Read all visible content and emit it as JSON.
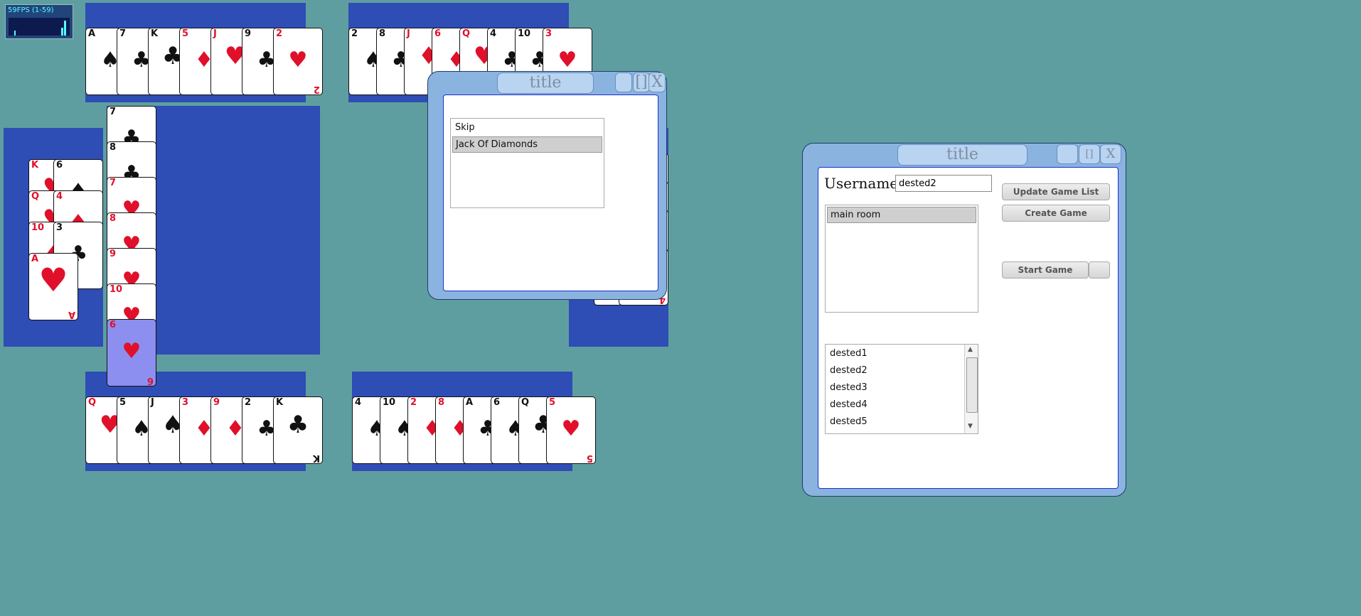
{
  "fps": {
    "label": "59FPS (1-59)"
  },
  "top_left_hand": [
    {
      "rank": "A",
      "suit": "♠",
      "color": "blk"
    },
    {
      "rank": "7",
      "suit": "♣",
      "color": "blk"
    },
    {
      "rank": "K",
      "suit": "♣",
      "color": "blk"
    },
    {
      "rank": "5",
      "suit": "♦",
      "color": "red"
    },
    {
      "rank": "J",
      "suit": "♥",
      "color": "red"
    },
    {
      "rank": "9",
      "suit": "♣",
      "color": "blk"
    },
    {
      "rank": "2",
      "suit": "♥",
      "color": "red"
    }
  ],
  "top_right_hand": [
    {
      "rank": "2",
      "suit": "♠",
      "color": "blk"
    },
    {
      "rank": "8",
      "suit": "♣",
      "color": "blk"
    },
    {
      "rank": "J",
      "suit": "♦",
      "color": "red"
    },
    {
      "rank": "6",
      "suit": "♦",
      "color": "red"
    },
    {
      "rank": "Q",
      "suit": "♥",
      "color": "red"
    },
    {
      "rank": "4",
      "suit": "♣",
      "color": "blk"
    },
    {
      "rank": "10",
      "suit": "♣",
      "color": "blk"
    },
    {
      "rank": "3",
      "suit": "♥",
      "color": "red"
    }
  ],
  "left_pile": [
    {
      "rank": "K",
      "suit": "♥",
      "color": "red"
    },
    {
      "rank": "6",
      "suit": "♠",
      "color": "blk"
    },
    {
      "rank": "Q",
      "suit": "♥",
      "color": "red"
    },
    {
      "rank": "4",
      "suit": "♦",
      "color": "red"
    },
    {
      "rank": "10",
      "suit": "♦",
      "color": "red"
    },
    {
      "rank": "3",
      "suit": "♣",
      "color": "blk"
    },
    {
      "rank": "A",
      "suit": "♥",
      "color": "red"
    }
  ],
  "center_column": [
    {
      "rank": "7",
      "suit": "♣",
      "color": "blk"
    },
    {
      "rank": "8",
      "suit": "♣",
      "color": "blk"
    },
    {
      "rank": "7",
      "suit": "♥",
      "color": "red"
    },
    {
      "rank": "8",
      "suit": "♥",
      "color": "red"
    },
    {
      "rank": "9",
      "suit": "♥",
      "color": "red"
    },
    {
      "rank": "10",
      "suit": "♥",
      "color": "red"
    },
    {
      "rank": "6",
      "suit": "♥",
      "color": "red"
    }
  ],
  "bottom_left_hand": [
    {
      "rank": "Q",
      "suit": "♥",
      "color": "red"
    },
    {
      "rank": "5",
      "suit": "♠",
      "color": "blk"
    },
    {
      "rank": "J",
      "suit": "♠",
      "color": "blk"
    },
    {
      "rank": "3",
      "suit": "♦",
      "color": "red"
    },
    {
      "rank": "9",
      "suit": "♦",
      "color": "red"
    },
    {
      "rank": "2",
      "suit": "♣",
      "color": "blk"
    },
    {
      "rank": "K",
      "suit": "♣",
      "color": "blk"
    }
  ],
  "bottom_right_hand": [
    {
      "rank": "4",
      "suit": "♠",
      "color": "blk"
    },
    {
      "rank": "10",
      "suit": "♠",
      "color": "blk"
    },
    {
      "rank": "2",
      "suit": "♦",
      "color": "red"
    },
    {
      "rank": "8",
      "suit": "♦",
      "color": "red"
    },
    {
      "rank": "A",
      "suit": "♣",
      "color": "blk"
    },
    {
      "rank": "6",
      "suit": "♠",
      "color": "blk"
    },
    {
      "rank": "Q",
      "suit": "♣",
      "color": "blk"
    },
    {
      "rank": "5",
      "suit": "♥",
      "color": "red"
    }
  ],
  "right_partial_card": {
    "rank": "4",
    "color": "red"
  },
  "choice_window": {
    "title": "title",
    "btn_restore": "[]",
    "btn_close": "X",
    "items": [
      "Skip",
      "Jack Of Diamonds"
    ],
    "selected_index": 1
  },
  "lobby_window": {
    "title": "title",
    "btn_restore": "[]",
    "btn_close": "X",
    "username_label": "Username:",
    "username_value": "dested2",
    "update_button": "Update Game List",
    "create_button": "Create Game",
    "start_button": "Start Game",
    "rooms": [
      "main room"
    ],
    "players": [
      "dested1",
      "dested2",
      "dested3",
      "dested4",
      "dested5"
    ],
    "scroll_up": "▲",
    "scroll_down": "▼"
  }
}
